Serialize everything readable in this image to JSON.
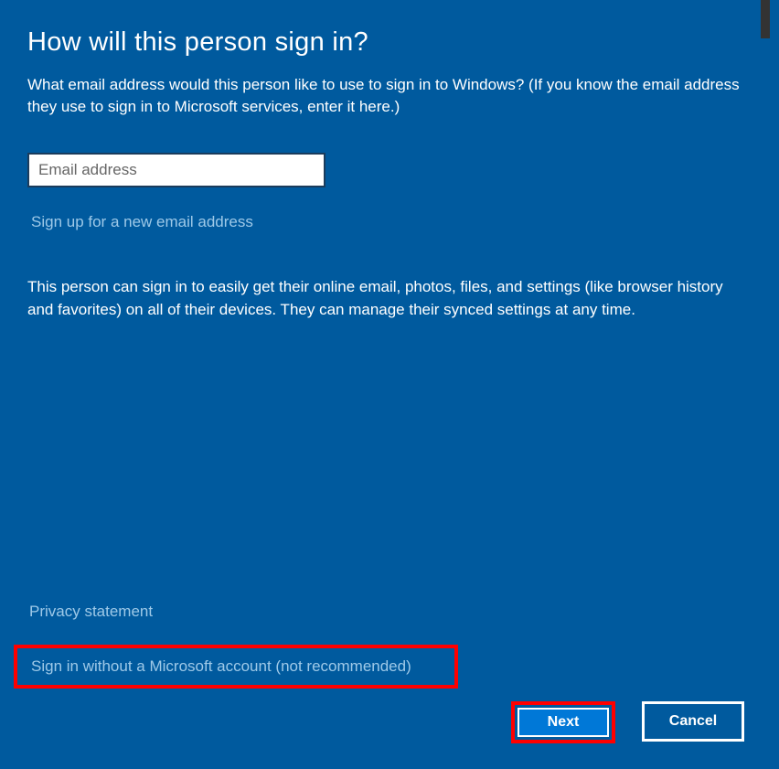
{
  "heading": "How will this person sign in?",
  "description": "What email address would this person like to use to sign in to Windows? (If you know the email address they use to sign in to Microsoft services, enter it here.)",
  "email_input": {
    "placeholder": "Email address",
    "value": ""
  },
  "signup_link": "Sign up for a new email address",
  "info_text": "This person can sign in to easily get their online email, photos, files, and settings (like browser history and favorites) on all of their devices. They can manage their synced settings at any time.",
  "privacy_link": "Privacy statement",
  "signin_without_link": "Sign in without a Microsoft account (not recommended)",
  "buttons": {
    "next": "Next",
    "cancel": "Cancel"
  }
}
